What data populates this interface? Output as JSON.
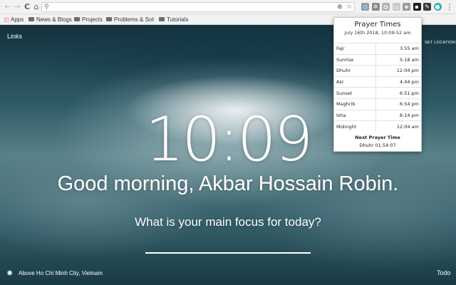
{
  "browser": {
    "omnibox_value": "",
    "bookmarks": [
      {
        "label": "Apps"
      },
      {
        "label": "News & Blogs"
      },
      {
        "label": "Projects"
      },
      {
        "label": "Problems & Solu"
      },
      {
        "label": "Tutorials"
      }
    ],
    "icons": {
      "back": "←",
      "forward": "→",
      "reload": "C",
      "home": "⌂",
      "search": "⚲",
      "target": "⊕",
      "star": "☆",
      "menu": "⋮"
    },
    "extensions": [
      {
        "name": "shield-extension-icon",
        "glyph": "◇",
        "color": "#8aa0b4"
      },
      {
        "name": "gear-extension-icon",
        "glyph": "✲",
        "color": "#8a8a8a"
      },
      {
        "name": "globe-extension-icon",
        "glyph": "◍",
        "color": "#b0b0b0"
      },
      {
        "name": "card-extension-icon",
        "glyph": "▭",
        "color": "#c9c9c9"
      },
      {
        "name": "badge-extension-icon",
        "glyph": "◈",
        "color": "#9a9a9a"
      },
      {
        "name": "mosque-extension-icon",
        "glyph": "▪",
        "color": "#1e1e1e"
      },
      {
        "name": "color-picker-extension-icon",
        "glyph": "✎",
        "color": "#3c3c3c"
      },
      {
        "name": "teal-extension-icon",
        "glyph": "●",
        "color": "#26b5b0"
      }
    ]
  },
  "page": {
    "links_label": "Links",
    "set_location_label": "SET LOCATION",
    "clock": "10:09",
    "greeting": "Good morning, Akbar Hossain Robin.",
    "focus_question": "What is your main focus for today?",
    "focus_value": "",
    "photo_location": "Above Ho Chi Minh City, Vietnam",
    "todo_label": "Todo",
    "settings_icon": "✹"
  },
  "prayer_popup": {
    "title": "Prayer Times",
    "date": "July 16th 2018, 10:09:52 am",
    "times": [
      {
        "name": "Fajr",
        "time": "3:55 am"
      },
      {
        "name": "Sunrise",
        "time": "5:18 am"
      },
      {
        "name": "Dhuhr",
        "time": "12:04 pm"
      },
      {
        "name": "Asr",
        "time": "4:44 pm"
      },
      {
        "name": "Sunset",
        "time": "6:51 pm"
      },
      {
        "name": "Maghrib",
        "time": "6:54 pm"
      },
      {
        "name": "Isha",
        "time": "8:14 pm"
      },
      {
        "name": "Midnight",
        "time": "12:04 am"
      }
    ],
    "next_label": "Next Prayer Time",
    "next_value": "Dhuhr 01:54:07"
  }
}
